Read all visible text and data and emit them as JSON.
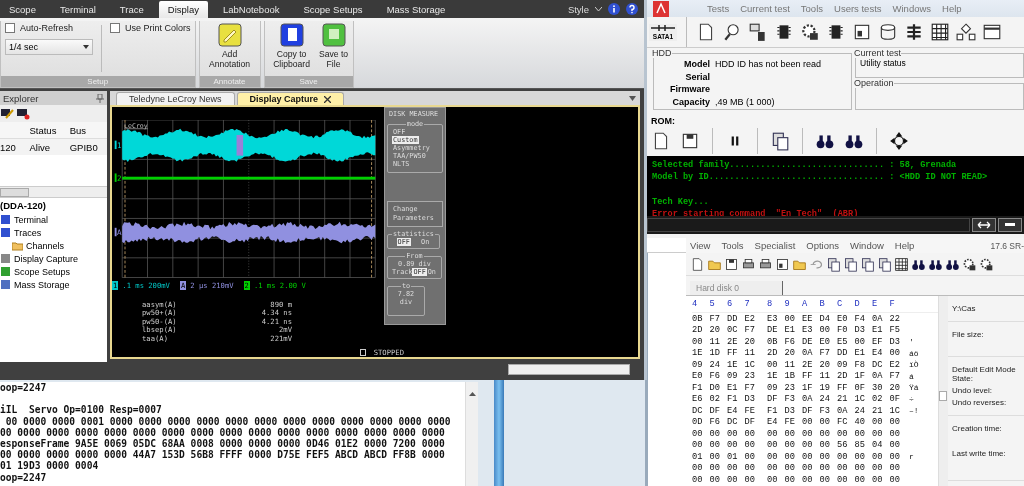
{
  "lecroy": {
    "tabs": [
      {
        "label": "Scope",
        "selected": false
      },
      {
        "label": "Terminal",
        "selected": false
      },
      {
        "label": "Trace",
        "selected": false
      },
      {
        "label": "Display",
        "selected": true
      },
      {
        "label": "LabNotebook",
        "selected": false
      },
      {
        "label": "Scope Setups",
        "selected": false
      },
      {
        "label": "Mass Storage",
        "selected": false
      }
    ],
    "style_menu": "Style",
    "ribbon": {
      "auto_refresh": {
        "label": "Auto-Refresh",
        "checked": false
      },
      "refresh_rate": "1/4 sec",
      "print_colors": {
        "label": "Use Print Colors",
        "checked": false
      },
      "groups": [
        {
          "label": "Setup"
        },
        {
          "label": "Annotate",
          "buttons": [
            "Add Annotation"
          ]
        },
        {
          "label": "Save",
          "buttons": [
            "Copy to Clipboard",
            "Save to File"
          ]
        }
      ]
    },
    "explorer": {
      "title": "Explorer",
      "columns": [
        "",
        "Status",
        "Bus"
      ],
      "rows": [
        [
          "120",
          "Alive",
          "GPIB0"
        ]
      ],
      "tree": {
        "label": "(DDA-120)",
        "children": [
          {
            "label": "Terminal"
          },
          {
            "label": "Traces"
          },
          {
            "label": "Channels"
          },
          {
            "label": "Display Capture"
          },
          {
            "label": "Scope Setups"
          },
          {
            "label": "Mass Storage"
          }
        ]
      }
    },
    "doc_tabs": [
      {
        "label": "Teledyne LeCroy News",
        "selected": false
      },
      {
        "label": "Display Capture",
        "selected": true
      }
    ],
    "scope": {
      "logo": "LeCroy",
      "traces": [
        {
          "label": "1",
          "color": "#00d8d8"
        },
        {
          "label": "2",
          "color": "#00d000"
        },
        {
          "label": "A",
          "color": "#9090e0"
        }
      ],
      "channels": [
        {
          "badge": "1",
          "text": ".1 ms 200mV",
          "color": "#00c8c8"
        },
        {
          "badge": "A",
          "text": "2 µs 210mV",
          "color": "#9090e0"
        },
        {
          "badge": "2",
          "text": ".1 ms 2.00 V",
          "color": "#00d000"
        }
      ],
      "measurements": [
        {
          "name": "aasym(A)",
          "value": "890 m"
        },
        {
          "name": "pw50+(A)",
          "value": "4.34 ns"
        },
        {
          "name": "pw50-(A)",
          "value": "4.21 ns"
        },
        {
          "name": "lbsep(A)",
          "value": "2mV"
        },
        {
          "name": "taa(A)",
          "value": "221mV"
        }
      ],
      "status": "STOPPED",
      "menu": {
        "title": "DISK MEASURE",
        "mode_title": "mode",
        "modes": [
          {
            "label": "OFF",
            "selected": false
          },
          {
            "label": "Custom",
            "selected": true
          },
          {
            "label": "Asymmetry",
            "selected": false
          },
          {
            "label": "TAA/PW50",
            "selected": false
          },
          {
            "label": "NLTS",
            "selected": false
          }
        ],
        "change": "Change Parameters",
        "statistics_title": "statistics",
        "statistics": [
          {
            "label": "OFF",
            "selected": true
          },
          {
            "label": "On",
            "selected": false
          }
        ],
        "from_title": "From",
        "from_value": "0.89 div",
        "track_label": "Track",
        "track": [
          {
            "label": "OFF",
            "selected": true
          },
          {
            "label": "On",
            "selected": false
          }
        ],
        "to_title": "to",
        "to_value": "7.82 div"
      }
    }
  },
  "hdd": {
    "menu": [
      "Tests",
      "Current test",
      "Tools",
      "Users tests",
      "Windows",
      "Help"
    ],
    "sata_button": "SATA1",
    "hdd_group": {
      "title": "HDD",
      "fields": [
        {
          "label": "Model",
          "value": "HDD ID has not been read"
        },
        {
          "label": "Serial"
        },
        {
          "label": "Firmware"
        },
        {
          "label": "Capacity",
          "value": ",49 MB (1 000)"
        }
      ]
    },
    "current_test": {
      "title": "Current test",
      "value": "Utility status"
    },
    "operation": {
      "title": "Operation"
    },
    "rom_label": "ROM:",
    "console": [
      {
        "kind": "info",
        "text": "Selected family.............................. : 58, Grenada"
      },
      {
        "kind": "info",
        "text": "Model by ID.................................. : <HDD ID NOT READ>"
      },
      {
        "kind": "blank"
      },
      {
        "kind": "info",
        "text": "Tech Key..."
      },
      {
        "kind": "error",
        "text": "Error starting command  \"En Tech\"  (ABR)"
      }
    ]
  },
  "hex": {
    "menu": [
      "View",
      "Tools",
      "Specialist",
      "Options",
      "Window",
      "Help"
    ],
    "version": "17.6 SR-",
    "tab": "Hard disk 0",
    "columns": [
      "4",
      "5",
      "6",
      "7",
      "8",
      "9",
      "A",
      "B",
      "C",
      "D",
      "E",
      "F"
    ],
    "rows": [
      {
        "bytes": [
          "0B",
          "F7",
          "DD",
          "E2",
          "E3",
          "00",
          "EE",
          "D4",
          "E0",
          "F4",
          "0A",
          "22"
        ]
      },
      {
        "bytes": [
          "2D",
          "20",
          "0C",
          "F7",
          "DE",
          "E1",
          "E3",
          "00",
          "F0",
          "D3",
          "E1",
          "F5"
        ]
      },
      {
        "bytes": [
          "00",
          "11",
          "2E",
          "20",
          "0B",
          "F6",
          "DE",
          "E0",
          "E5",
          "00",
          "EF",
          "D3"
        ],
        "text": "'"
      },
      {
        "bytes": [
          "1E",
          "1D",
          "FF",
          "11",
          "2D",
          "20",
          "0A",
          "F7",
          "DD",
          "E1",
          "E4",
          "00"
        ],
        "text": "áö"
      },
      {
        "bytes": [
          "09",
          "24",
          "1E",
          "1C",
          "00",
          "11",
          "2E",
          "20",
          "09",
          "F8",
          "DC",
          "E2"
        ],
        "text": "ïÒ"
      },
      {
        "bytes": [
          "E0",
          "F6",
          "09",
          "23",
          "1E",
          "1B",
          "FF",
          "11",
          "2D",
          "1F",
          "0A",
          "F7"
        ],
        "text": "á"
      },
      {
        "bytes": [
          "F1",
          "D0",
          "E1",
          "F7",
          "09",
          "23",
          "1F",
          "19",
          "FF",
          "0F",
          "30",
          "20"
        ],
        "text": "Ÿá"
      },
      {
        "bytes": [
          "E6",
          "02",
          "F1",
          "D3",
          "DF",
          "F3",
          "0A",
          "24",
          "21",
          "1C",
          "02",
          "0F"
        ],
        "text": "÷"
      },
      {
        "bytes": [
          "DC",
          "DF",
          "E4",
          "FE",
          "F1",
          "D3",
          "DF",
          "F3",
          "0A",
          "24",
          "21",
          "1C"
        ],
        "text": "–!"
      },
      {
        "bytes": [
          "0D",
          "F6",
          "DC",
          "DF",
          "E4",
          "FE",
          "00",
          "00",
          "FC",
          "40",
          "00",
          "00"
        ]
      },
      {
        "bytes": [
          "00",
          "00",
          "00",
          "00",
          "00",
          "00",
          "00",
          "00",
          "00",
          "00",
          "00",
          "00"
        ]
      },
      {
        "bytes": [
          "00",
          "00",
          "00",
          "00",
          "00",
          "00",
          "00",
          "00",
          "56",
          "85",
          "04",
          "00"
        ]
      },
      {
        "bytes": [
          "01",
          "00",
          "01",
          "00",
          "00",
          "00",
          "00",
          "00",
          "00",
          "00",
          "00",
          "00"
        ],
        "text": "r"
      },
      {
        "bytes": [
          "00",
          "00",
          "00",
          "00",
          "00",
          "00",
          "00",
          "00",
          "00",
          "00",
          "00",
          "00"
        ]
      },
      {
        "bytes": [
          "00",
          "00",
          "00",
          "00",
          "00",
          "00",
          "00",
          "00",
          "00",
          "00",
          "00",
          "00"
        ]
      }
    ],
    "info": {
      "path": "Y:\\Cas",
      "sections": [
        [
          "File size:"
        ],
        [
          "Default Edit Mode State:",
          "Undo level:",
          "Undo reverses:"
        ],
        [
          "Creation time:",
          "Last write time:"
        ]
      ]
    }
  },
  "terminal": {
    "lines": [
      {
        "kind": "text",
        "text": "oop=2247"
      },
      {
        "kind": "blank"
      },
      {
        "kind": "text",
        "text": "iIL  Servo Op=0100 Resp=0007"
      },
      {
        "kind": "text",
        "text": " 00 0000 0000 0001 0000 0000 0000 0000 0000 0000 0000 0000 0000 0000 0000 0000"
      },
      {
        "kind": "text",
        "text": "00 0000 0000 0000 0000 0000 0000 0000 0000 0000 0000 0000 0000 0000 0000 0000"
      },
      {
        "kind": "text",
        "text": "esponseFrame 9A5E 0069 05DC 68AA 0008 0000 0000 0000 0D46 01E2 0000 7200 0000"
      },
      {
        "kind": "text",
        "text": "00 0000 0000 0000 0000 44A7 153D 56B8 FFFF 0000 D75E FEF5 ABCD ABCD FF8B 0000"
      },
      {
        "kind": "text",
        "text": "01 19D3 0000 0004"
      },
      {
        "kind": "text",
        "text": "oop=2247"
      }
    ]
  }
}
